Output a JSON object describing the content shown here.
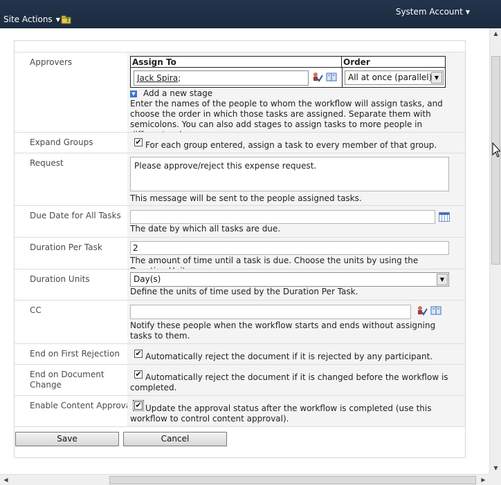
{
  "topbar": {
    "site_actions": "Site Actions",
    "account": "System Account"
  },
  "form": {
    "approvers": {
      "label": "Approvers",
      "col_assign_to": "Assign To",
      "col_order": "Order",
      "assignee": "Jack Spira",
      "assignee_suffix": ";",
      "order_value": "All at once (parallel)",
      "add_stage": "Add a new stage",
      "description": "Enter the names of the people to whom the workflow will assign tasks, and choose the order in which those tasks are assigned. Separate them with semicolons. You can also add stages to assign tasks to more people in different orders."
    },
    "expand_groups": {
      "label": "Expand Groups",
      "checked": true,
      "text": "For each group entered, assign a task to every member of that group."
    },
    "request": {
      "label": "Request",
      "value": "Please approve/reject this expense request.",
      "description": "This message will be sent to the people assigned tasks."
    },
    "due_date": {
      "label": "Due Date for All Tasks",
      "value": "",
      "description": "The date by which all tasks are due."
    },
    "duration_per_task": {
      "label": "Duration Per Task",
      "value": "2",
      "description": "The amount of time until a task is due. Choose the units by using the Duration Units."
    },
    "duration_units": {
      "label": "Duration Units",
      "value": "Day(s)",
      "description": "Define the units of time used by the Duration Per Task."
    },
    "cc": {
      "label": "CC",
      "value": "",
      "description": "Notify these people when the workflow starts and ends without assigning tasks to them."
    },
    "end_on_first_rejection": {
      "label": "End on First Rejection",
      "checked": true,
      "text": "Automatically reject the document if it is rejected by any participant."
    },
    "end_on_document_change": {
      "label": "End on Document Change",
      "checked": true,
      "text": "Automatically reject the document if it is changed before the workflow is completed."
    },
    "enable_content_approval": {
      "label": "Enable Content Approval",
      "checked": true,
      "text": "Update the approval status after the workflow is completed (use this workflow to control content approval)."
    }
  },
  "buttons": {
    "save": "Save",
    "cancel": "Cancel"
  },
  "checkmark": "✔",
  "colors": {
    "topbar": "#1b2b40",
    "field_bg": "#f4f4f4",
    "link_blue": "#3a74c8"
  }
}
